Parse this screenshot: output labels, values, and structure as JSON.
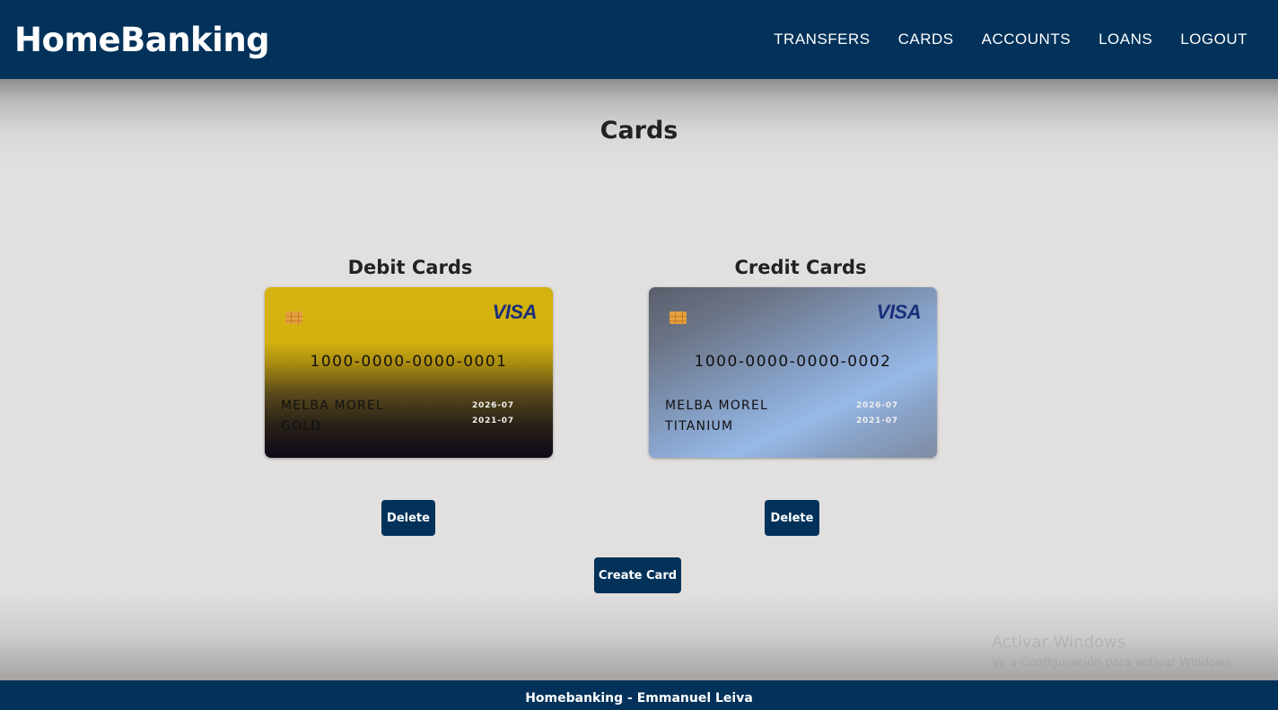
{
  "navbar": {
    "brand": "HomeBanking",
    "links": [
      "TRANSFERS",
      "CARDS",
      "ACCOUNTS",
      "LOANS",
      "LOGOUT"
    ]
  },
  "page": {
    "title": "Cards"
  },
  "debit": {
    "section_title": "Debit Cards",
    "card": {
      "brand": "VISA",
      "number": "1000-0000-0000-0001",
      "holder": "MELBA MOREL",
      "tier": "GOLD",
      "thru_date": "2026-07",
      "from_date": "2021-07"
    },
    "delete_label": "Delete"
  },
  "credit": {
    "section_title": "Credit Cards",
    "card": {
      "brand": "VISA",
      "number": "1000-0000-0000-0002",
      "holder": "MELBA MOREL",
      "tier": "TITANIUM",
      "thru_date": "2026-07",
      "from_date": "2021-07"
    },
    "delete_label": "Delete"
  },
  "create_card_label": "Create Card",
  "watermark": {
    "line1": "Activar Windows",
    "line2": "Ve a Configuración para activar Windows."
  },
  "footer": {
    "text": "Homebanking - Emmanuel Leiva"
  },
  "colors": {
    "primary": "#02325a",
    "background": "#e2e0df"
  }
}
